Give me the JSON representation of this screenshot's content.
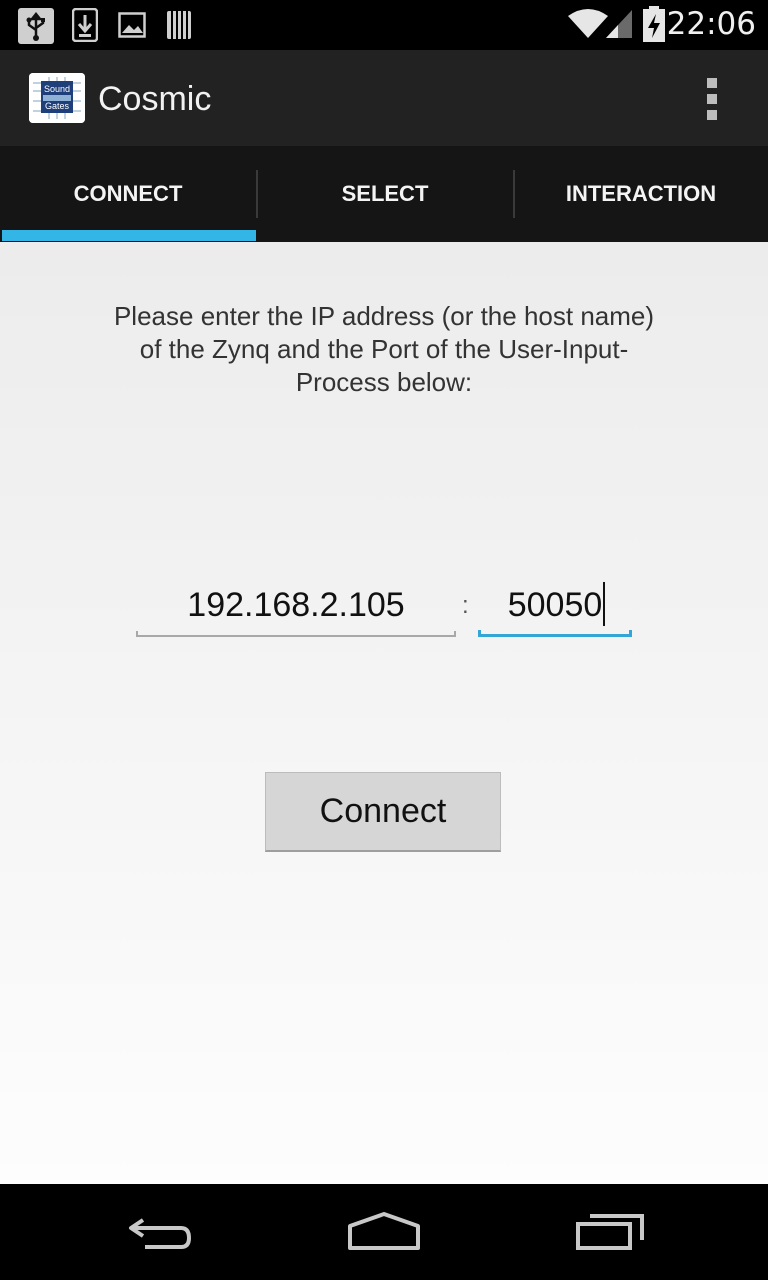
{
  "status_bar": {
    "time": "22:06",
    "left_icons": [
      "usb-icon",
      "download-icon",
      "image-icon",
      "barcode-icon"
    ],
    "right_icons": [
      "wifi-icon",
      "signal-icon",
      "battery-charging-icon"
    ]
  },
  "action_bar": {
    "app_icon_text": [
      "Sound",
      "Gates"
    ],
    "title": "Cosmic",
    "overflow_icon": "overflow-menu-icon"
  },
  "tabs": [
    {
      "label": "CONNECT",
      "selected": true
    },
    {
      "label": "SELECT",
      "selected": false
    },
    {
      "label": "INTERACTION",
      "selected": false
    }
  ],
  "connect_form": {
    "instructions": "Please enter the IP address (or the host name) of the Zynq and the Port of the User-Input-Process below:",
    "ip_value": "192.168.2.105",
    "separator": ":",
    "port_value": "50050",
    "connect_label": "Connect"
  },
  "nav_bar": {
    "buttons": [
      "back-icon",
      "home-icon",
      "recents-icon"
    ]
  },
  "colors": {
    "accent": "#33b5e5",
    "action_bar": "#222222",
    "tab_bar": "#151515",
    "button": "#d6d6d6"
  }
}
